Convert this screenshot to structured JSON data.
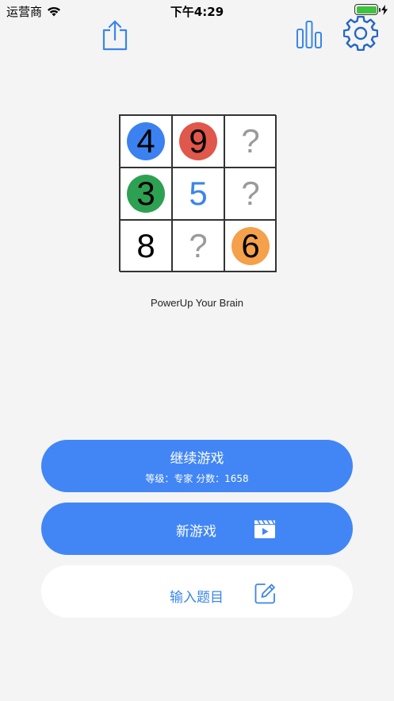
{
  "status_bar": {
    "carrier": "运营商",
    "time": "下午4:29"
  },
  "grid": {
    "cells": [
      {
        "value": "4",
        "circle_color": "#3b82f0"
      },
      {
        "value": "9",
        "circle_color": "#e0574b"
      },
      {
        "value": "?",
        "circle_color": ""
      },
      {
        "value": "3",
        "circle_color": "#2ea052"
      },
      {
        "value": "5",
        "circle_color": ""
      },
      {
        "value": "?",
        "circle_color": ""
      },
      {
        "value": "8",
        "circle_color": ""
      },
      {
        "value": "?",
        "circle_color": ""
      },
      {
        "value": "6",
        "circle_color": "#f5a04a"
      }
    ]
  },
  "tagline": "PowerUp Your Brain",
  "buttons": {
    "continue_label": "继续游戏",
    "continue_sub": "等级：专家 分数：1658",
    "new_game_label": "新游戏",
    "input_label": "输入题目"
  },
  "colors": {
    "accent": "#4286f5",
    "background": "#f4f4f4"
  }
}
